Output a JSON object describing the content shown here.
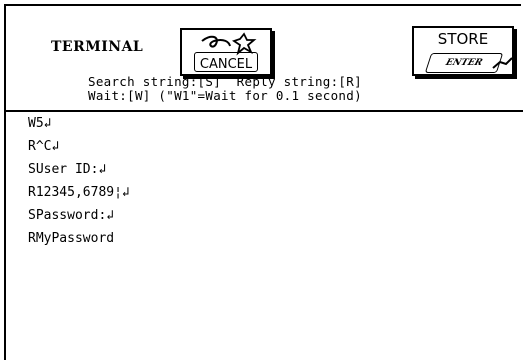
{
  "header": {
    "title": "TERMINAL",
    "cancel_label": "CANCEL",
    "store_label": "STORE",
    "enter_label": "ENTER",
    "hint_line1": "Search string:[S]  Reply string:[R]",
    "hint_line2": "Wait:[W] (\"W1\"=Wait for 0.1 second)"
  },
  "script": {
    "lines": [
      "W5↲",
      "R^C↲",
      "SUser ID:↲",
      "R12345,6789¦↲",
      "SPassword:↲",
      "RMyPassword"
    ]
  }
}
